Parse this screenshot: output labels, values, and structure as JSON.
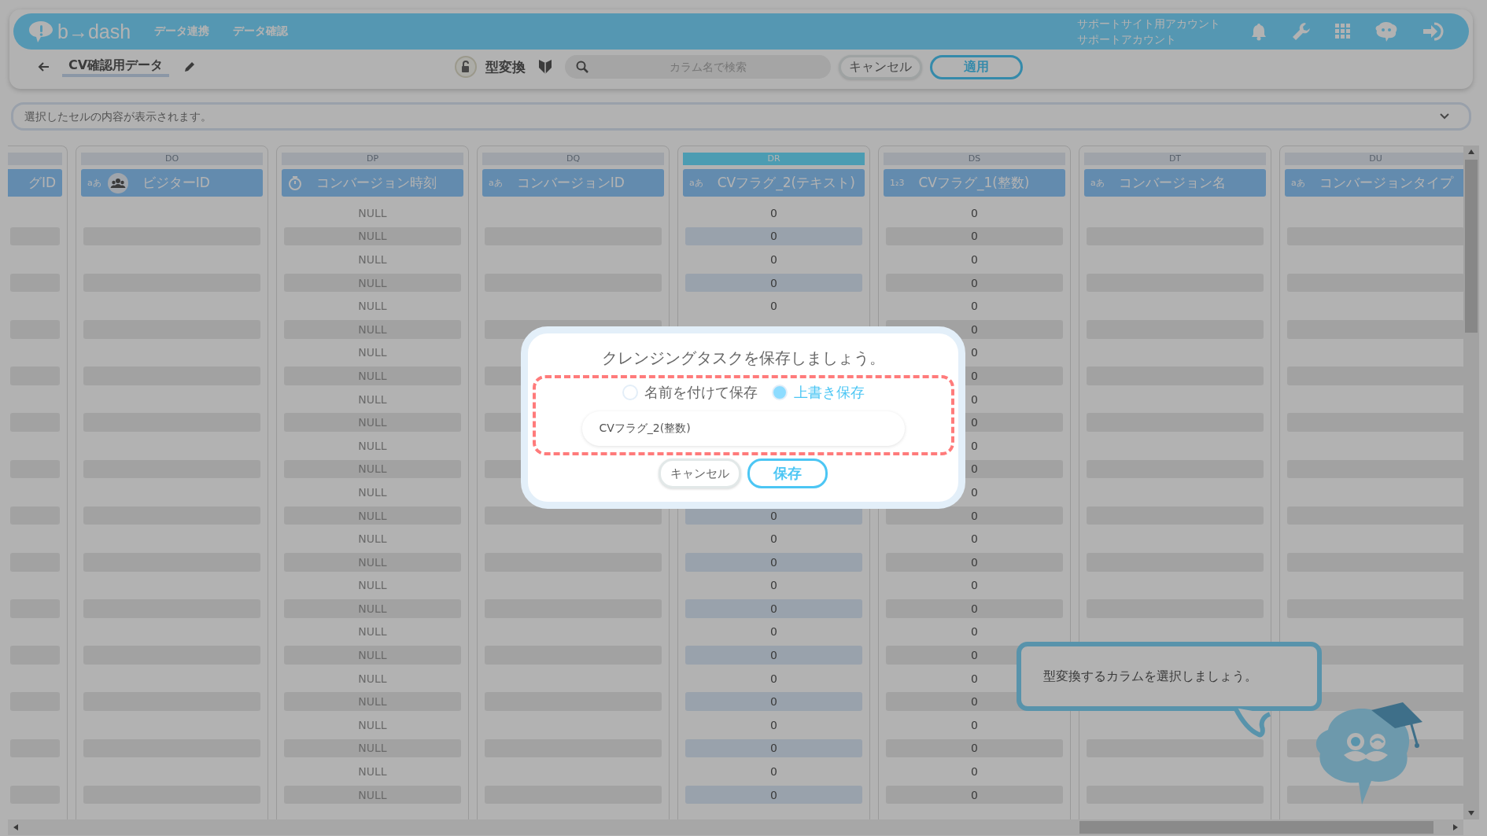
{
  "header": {
    "logo": "b→dash",
    "nav": [
      {
        "label": "データ連携"
      },
      {
        "label": "データ確認"
      }
    ],
    "account": [
      "サポートサイト用アカウント",
      "サポートアカウント"
    ]
  },
  "toolbar": {
    "title": "CV確認用データ",
    "mode": "型変換",
    "search_placeholder": "カラム名で検索",
    "cancel": "キャンセル",
    "apply": "適用"
  },
  "cell_viewer": {
    "placeholder": "選択したセルの内容が表示されます。"
  },
  "columns": [
    {
      "kind": "partial",
      "name": "グID",
      "selected": false
    },
    {
      "letter": "DO",
      "kind": "text",
      "type_label": "aあ",
      "visitor": true,
      "name": "ビジターID",
      "selected": false
    },
    {
      "letter": "DP",
      "kind": "datetime",
      "name": "コンバージョン時刻",
      "selected": false,
      "cells": [
        "NULL",
        "NULL",
        "NULL",
        "NULL",
        "NULL",
        "NULL",
        "NULL",
        "NULL",
        "NULL",
        "NULL",
        "NULL",
        "NULL",
        "NULL",
        "NULL",
        "NULL",
        "NULL",
        "NULL",
        "NULL",
        "NULL",
        "NULL",
        "NULL",
        "NULL",
        "NULL",
        "NULL",
        "NULL",
        "NULL"
      ]
    },
    {
      "letter": "DQ",
      "kind": "text",
      "type_label": "aあ",
      "visitor": false,
      "name": "コンバージョンID",
      "selected": false
    },
    {
      "letter": "DR",
      "kind": "text",
      "type_label": "aあ",
      "visitor": false,
      "name": "CVフラグ_2(テキスト)",
      "selected": true,
      "cells": [
        "0",
        "0",
        "0",
        "0",
        "0",
        null,
        null,
        null,
        null,
        null,
        null,
        null,
        null,
        "0",
        "0",
        "0",
        "0",
        "0",
        "0",
        "0",
        "0",
        "0",
        "0",
        "0",
        "0",
        "0"
      ]
    },
    {
      "letter": "DS",
      "kind": "number",
      "type_label": "1₂3",
      "visitor": false,
      "name": "CVフラグ_1(整数)",
      "selected": false,
      "cells": [
        "0",
        "0",
        "0",
        "0",
        "0",
        "0",
        "0",
        "0",
        "0",
        "0",
        "0",
        "0",
        "0",
        "0",
        "0",
        "0",
        "0",
        "0",
        "0",
        "0",
        "0",
        "0",
        "0",
        "0",
        "0",
        "0"
      ]
    },
    {
      "letter": "DT",
      "kind": "text",
      "type_label": "aあ",
      "visitor": false,
      "name": "コンバージョン名",
      "selected": false
    },
    {
      "letter": "DU",
      "kind": "text",
      "type_label": "aあ",
      "visitor": false,
      "name": "コンバージョンタイプ",
      "selected": false
    }
  ],
  "guide": {
    "message": "型変換するカラムを選択しましょう。"
  },
  "dialog": {
    "title": "クレンジングタスクを保存しましょう。",
    "options": [
      {
        "label": "名前を付けて保存",
        "selected": false
      },
      {
        "label": "上書き保存",
        "selected": true
      }
    ],
    "name_value": "CVフラグ_2(整数)",
    "cancel": "キャンセル",
    "save": "保存"
  }
}
